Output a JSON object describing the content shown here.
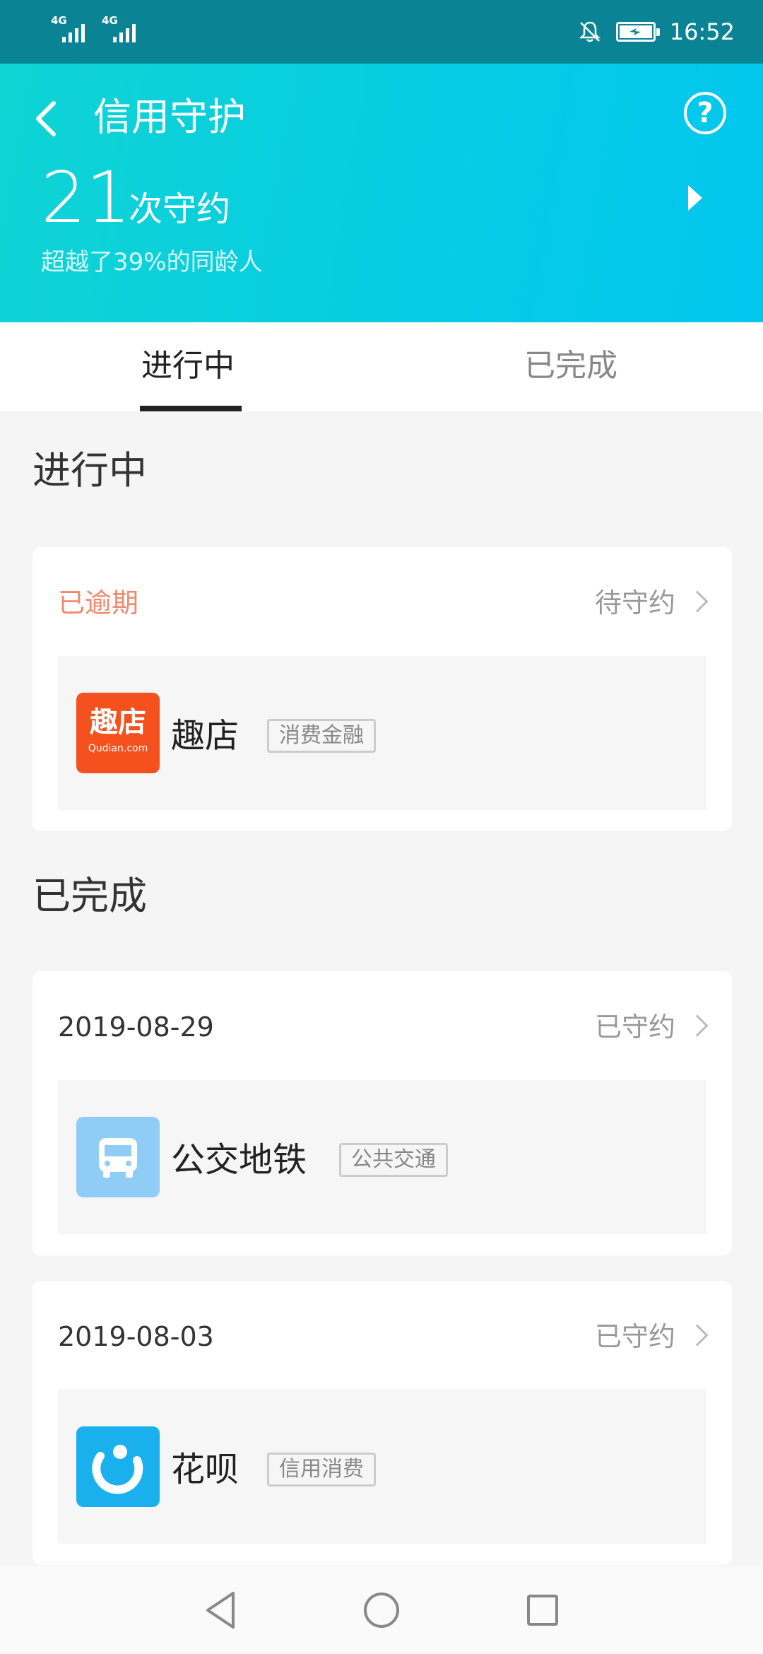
{
  "status_bar": {
    "signal1": "4G",
    "signal2": "4G",
    "time": "16:52",
    "icons": [
      "mute-bell-icon",
      "battery-icon"
    ]
  },
  "header": {
    "title": "信用守护",
    "count": "21",
    "count_unit": "次守约",
    "subtitle": "超越了39%的同龄人",
    "icons": [
      "back-icon",
      "help-icon",
      "arrow-right-icon"
    ]
  },
  "tabs": [
    {
      "label": "进行中",
      "active": true
    },
    {
      "label": "已完成",
      "active": false
    }
  ],
  "in_progress": {
    "section_title": "进行中",
    "items": [
      {
        "status": "已逾期",
        "action": "待守约",
        "app": "趣店",
        "tag": "消费金融",
        "logo_text": "趣店",
        "logo_sub": "Qudian.com",
        "status_color": "#f08a6e"
      }
    ]
  },
  "completed": {
    "section_title": "已完成",
    "items": [
      {
        "date": "2019-08-29",
        "action": "已守约",
        "app": "公交地铁",
        "tag": "公共交通"
      },
      {
        "date": "2019-08-03",
        "action": "已守约",
        "app": "花呗",
        "tag": "信用消费"
      }
    ]
  },
  "nav_bar": {
    "icons": [
      "back-triangle-icon",
      "home-circle-icon",
      "recents-square-icon"
    ]
  },
  "colors": {
    "header_start": "#0fd4d4",
    "header_end": "#02c7ef",
    "overdue": "#f08a6e",
    "qudian_brand": "#f4511e",
    "bus_blue": "#8fcdf7",
    "huabei_blue": "#1ab0ee"
  }
}
